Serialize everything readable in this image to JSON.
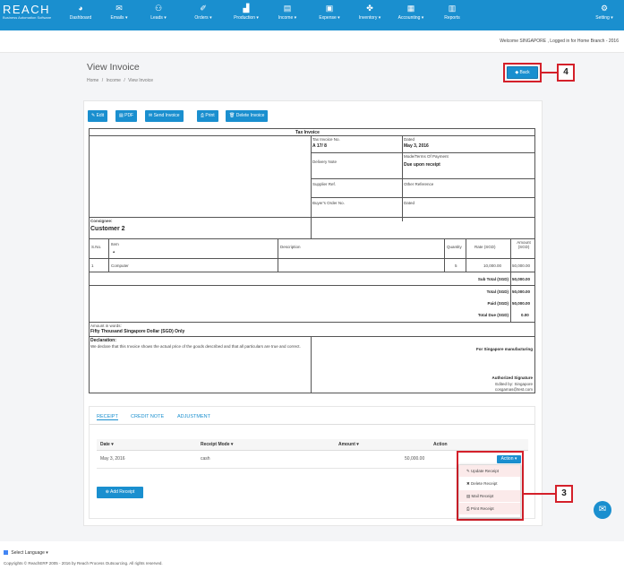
{
  "brand": {
    "name": "REACH",
    "tagline": "Business Automation Software"
  },
  "nav": {
    "items": [
      {
        "label": "Dashboard",
        "icon": "dashboard-icon"
      },
      {
        "label": "Emails ▾",
        "icon": "envelope-icon"
      },
      {
        "label": "Leads ▾",
        "icon": "users-icon"
      },
      {
        "label": "Orders ▾",
        "icon": "cart-icon"
      },
      {
        "label": "Production ▾",
        "icon": "factory-icon"
      },
      {
        "label": "Income ▾",
        "icon": "income-icon"
      },
      {
        "label": "Expense ▾",
        "icon": "money-icon"
      },
      {
        "label": "Inventory ▾",
        "icon": "cubes-icon"
      },
      {
        "label": "Accounting ▾",
        "icon": "calculator-icon"
      },
      {
        "label": "Reports",
        "icon": "report-icon"
      }
    ],
    "settings": "Setting ▾"
  },
  "welcome": "Welcome SINGAPORE , Logged in for Home Branch - 2016",
  "page": {
    "title": "View Invoice",
    "breadcrumb": [
      "Home",
      "/",
      "Income",
      "/",
      "View Invoice"
    ]
  },
  "back_button": "◆ Back",
  "callouts": {
    "back": "4",
    "action": "3"
  },
  "toolbar": {
    "edit": "✎ Edit",
    "pdf": "▤ PDF",
    "send": "✉ Send Invoice",
    "print": "⎙ Print",
    "delete": "🗑 Delete Invoice"
  },
  "invoice": {
    "heading": "Tax Invoice",
    "tax_invoice_no_label": "Tax Invoice No.",
    "tax_invoice_no": "A 17/ 8",
    "dated_label": "Dated",
    "dated": "May 3, 2016",
    "delivery_note_label": "Delivery Note",
    "mode_terms_label": "Mode/Terms Of Payment",
    "mode_terms": "Due upon receipt",
    "supplier_ref_label": "Supplier Ref.",
    "other_reference_label": "Other Reference",
    "buyer_order_label": "Buyer's Order No.",
    "dated2_label": "Dated",
    "consignee_label": "Consignee:",
    "consignee": "Customer 2",
    "headers": {
      "sno": "S.No.",
      "item": "Item",
      "item_arrow": "▴",
      "description": "Description",
      "quantity": "Quantity",
      "rate": "Rate (SGD)",
      "amount": "Amount (SGD)"
    },
    "rows": [
      {
        "sno": "1",
        "item": "Computer",
        "description": "",
        "quantity": "5",
        "rate": "10,000.00",
        "amount": "50,000.00"
      }
    ],
    "totals": [
      {
        "label": "Sub Total (SGD)",
        "value": "50,000.00"
      },
      {
        "label": "Total (SGD)",
        "value": "50,000.00"
      },
      {
        "label": "Paid (SGD)",
        "value": "50,000.00"
      },
      {
        "label": "Total Due (SGD)",
        "value": "0.00"
      }
    ],
    "amount_words_label": "Amount in words:",
    "amount_words": "Fifty Thousand Singapore Dollar (SGD) Only",
    "declaration_label": "Declaration:",
    "declaration": "We declare that this Invoice shows the actual price of the goods described and that all particulars are true and correct.",
    "for_company": "For Singapore manufacturing",
    "signatory": "Authorized Signature",
    "edited_by": "Edited by: Singapore",
    "email": "cosgamas@test.com"
  },
  "tabs": [
    "RECEIPT",
    "CREDIT NOTE",
    "ADJUSTMENT"
  ],
  "receipt_table": {
    "headers": [
      "Date ▾",
      "Receipt Mode ▾",
      "Amount ▾",
      "Action"
    ],
    "rows": [
      {
        "date": "May 3, 2016",
        "mode": "cash",
        "amount": "50,000.00"
      }
    ],
    "action_button": "Action ▾"
  },
  "dropdown": [
    "✎ Update Receipt",
    "✖ Delete Receipt",
    "▤ Mail Receipt",
    "⎙ Print Receipt"
  ],
  "add_receipt": "⊕ Add Receipt",
  "footer": {
    "language": "Select Language ▾",
    "copyright": "Copyrights © ReachERP 2005 - 2016 by Reach Process Outsourcing. All rights reserved."
  },
  "colors": {
    "primary": "#1a8fcf",
    "highlight": "#d4202a"
  }
}
